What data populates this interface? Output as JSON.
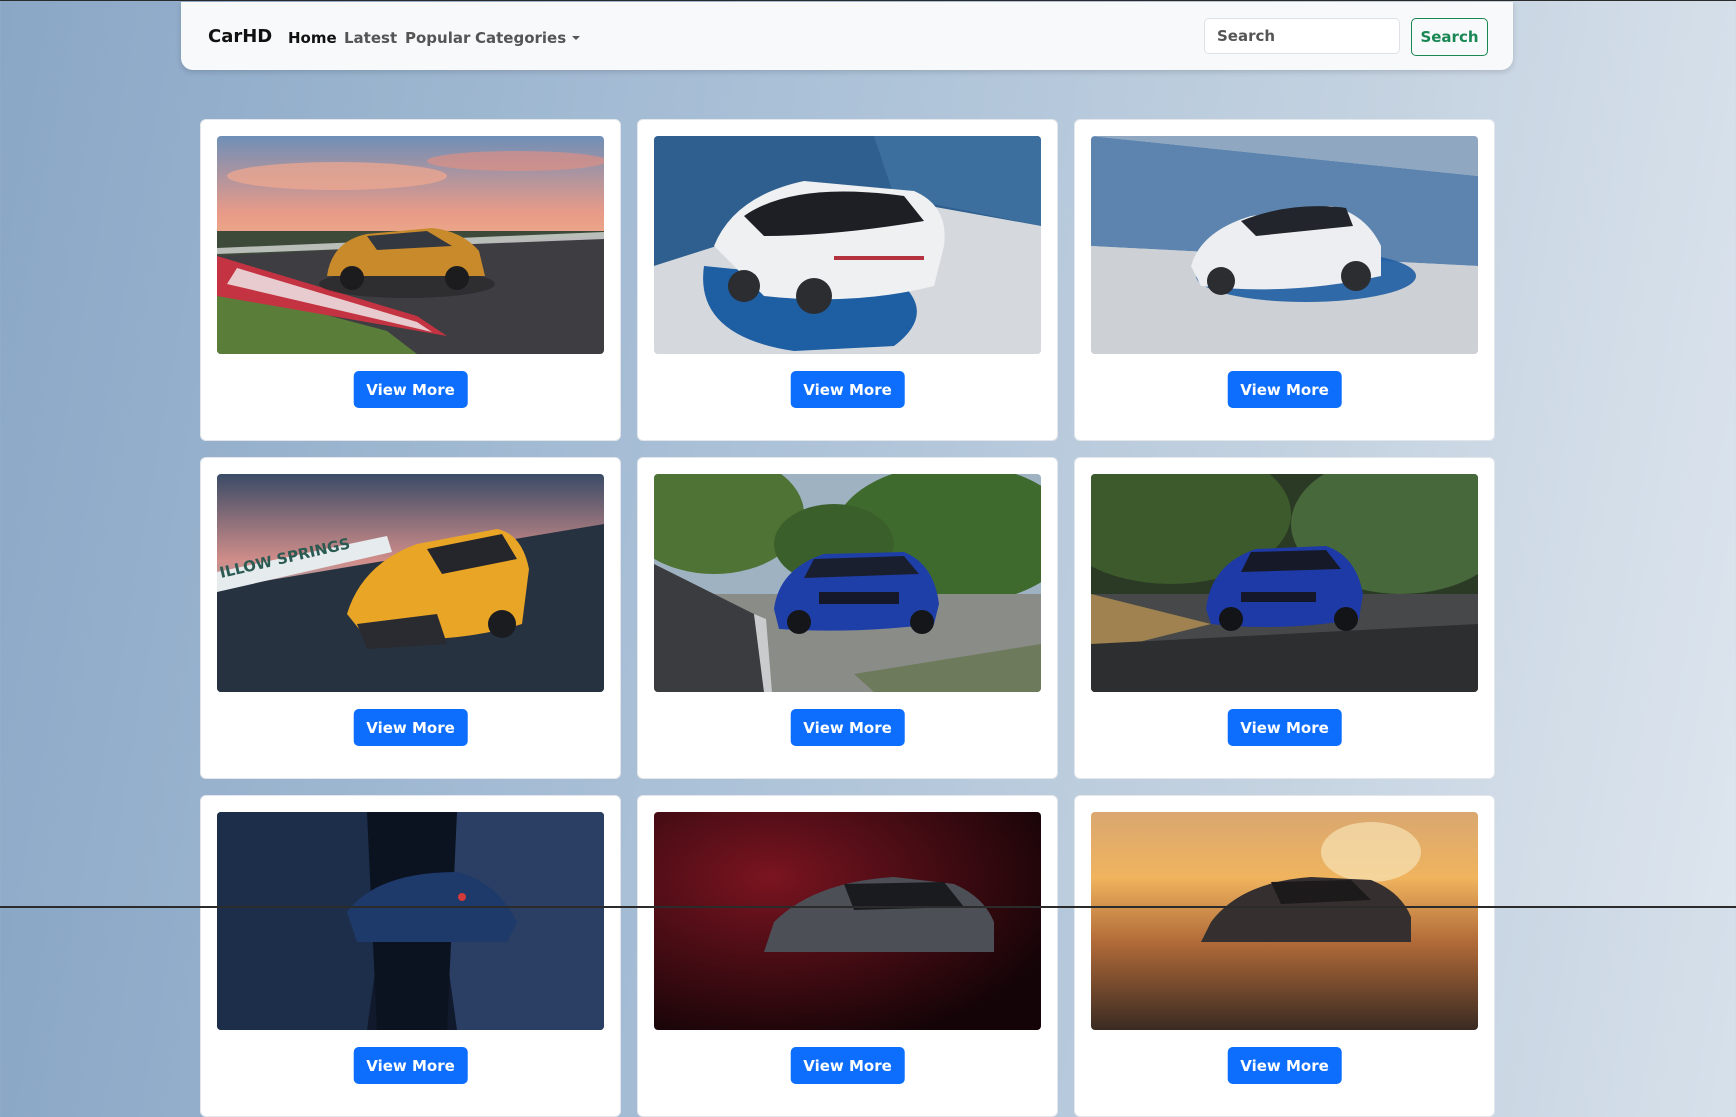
{
  "navbar": {
    "brand": "CarHD",
    "links": [
      "Home",
      "Latest",
      "Popular",
      "Categories"
    ],
    "search_placeholder": "Search",
    "search_button": "Search"
  },
  "cards": [
    {
      "button": "View More"
    },
    {
      "button": "View More"
    },
    {
      "button": "View More"
    },
    {
      "button": "View More"
    },
    {
      "button": "View More"
    },
    {
      "button": "View More"
    },
    {
      "button": "View More"
    },
    {
      "button": "View More"
    },
    {
      "button": "View More"
    }
  ],
  "photo_text": {
    "track_sign": "ILLOW SPRINGS"
  },
  "colors": {
    "primary": "#0d6efd",
    "success": "#198754"
  }
}
